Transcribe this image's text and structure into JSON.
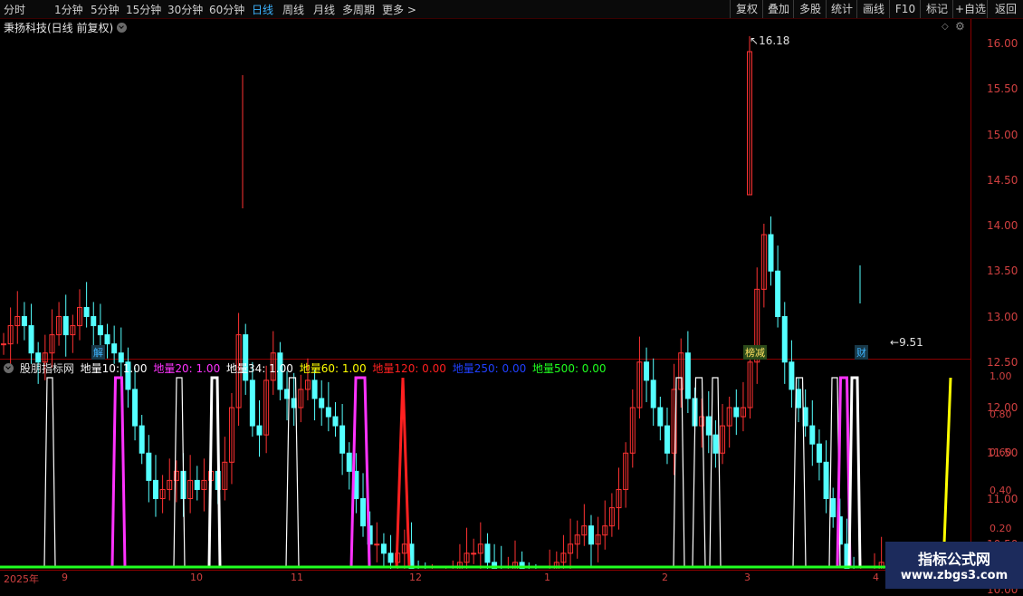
{
  "toolbar": {
    "left_items": [
      "分时",
      "1分钟",
      "5分钟",
      "15分钟",
      "30分钟",
      "60分钟",
      "日线",
      "周线",
      "月线",
      "多周期",
      "更多 >"
    ],
    "right_items": [
      "复权",
      "叠加",
      "多股",
      "统计",
      "画线",
      "F10",
      "标记",
      "+自选",
      "返回"
    ]
  },
  "stock_title": "秉扬科技(日线 前复权)",
  "price_axis": [
    "16.00",
    "15.50",
    "15.00",
    "14.50",
    "14.00",
    "13.50",
    "13.00",
    "12.50",
    "12.00",
    "11.50",
    "11.00",
    "10.50",
    "10.00"
  ],
  "indicator_axis": [
    "1.00",
    "0.80",
    "0.60",
    "0.40",
    "0.20"
  ],
  "annotations": {
    "high": "16.18",
    "low": "9.51",
    "tag_jie": "解",
    "tag_bang": "榜减",
    "tag_cai": "财"
  },
  "indicator": {
    "name": "股朋指标网",
    "legend": [
      {
        "text": "地量10: 1.00",
        "color": "#ffffff"
      },
      {
        "text": "地量20: 1.00",
        "color": "#ff33ff"
      },
      {
        "text": "地量34: 1.00",
        "color": "#ffffff"
      },
      {
        "text": "地量60: 1.00",
        "color": "#ffff00"
      },
      {
        "text": "地量120: 0.00",
        "color": "#ff2020"
      },
      {
        "text": "地量250: 0.00",
        "color": "#2040ff"
      },
      {
        "text": "地量500: 0.00",
        "color": "#20ff20"
      }
    ]
  },
  "date_axis": [
    "2025年",
    "9",
    "10",
    "11",
    "12",
    "1",
    "2",
    "3",
    "4"
  ],
  "watermark": {
    "line1": "指标公式网",
    "line2": "www.zbgs3.com"
  },
  "colors": {
    "up": "#ff3232",
    "down": "#54ffff",
    "grid": "#8b0000"
  }
}
